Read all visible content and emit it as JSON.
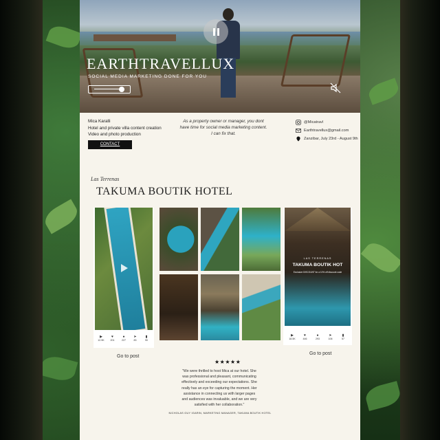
{
  "brand": {
    "title": "EARTHTRAVELLUX",
    "subtitle": "SOCIAL MEDIA MARKETING DONE FOR YOU"
  },
  "profile": {
    "name": "Mica Karalli",
    "line1": "Hotel and private villa content creation",
    "line2": "Video and photo production",
    "contact_label": "CONTACT"
  },
  "pitch": {
    "line1": "As a property owner or manager, you dont",
    "line2": "have time for social media marketing content.",
    "line3": "I can fix that."
  },
  "contact": {
    "instagram": "@Micatravl",
    "email": "Earthtravellux@gmail.com",
    "location": "Zanzibar, July 23rd - August 9th"
  },
  "section": {
    "location": "Las Terrenas",
    "hotel": "TAKUMA BOUTIK HOTEL"
  },
  "post_left": {
    "stats": [
      "12.9K",
      "201",
      "227",
      "83",
      "90"
    ],
    "go_label": "Go to post"
  },
  "post_right": {
    "brand": "LAS TERRENAS",
    "title": "TAKUMA BOUTIK HOT",
    "caption": "Exclusive DISCOUNT for a 10% off discount code",
    "stats": [
      "18.5K",
      "446",
      "293",
      "106",
      "57"
    ],
    "go_label": "Go to post"
  },
  "review": {
    "stars": "★★★★★",
    "quote": "\"We were thrilled to host Mica at our hotel. She was professional and pleasant, communicating effectively and exceeding our expectations. She really has an eye for capturing the moment. Her assistance in connecting us with larger pages and audiences was invaluable, and we are very satisfied with her collaboration.\"",
    "reviewer": "NICHOLAS GUY IGARIN, MARKETING MANAGER, TAKUMA BOUTIK HOTEL"
  },
  "icons": [
    "pause-icon",
    "mute-icon",
    "instagram-icon",
    "mail-icon",
    "location-pin-icon",
    "play-icon",
    "heart-icon",
    "comment-icon",
    "share-icon",
    "bookmark-icon"
  ],
  "colors": {
    "page": "#f7f4ec",
    "button": "#111111",
    "accent_white": "#ffffff"
  }
}
